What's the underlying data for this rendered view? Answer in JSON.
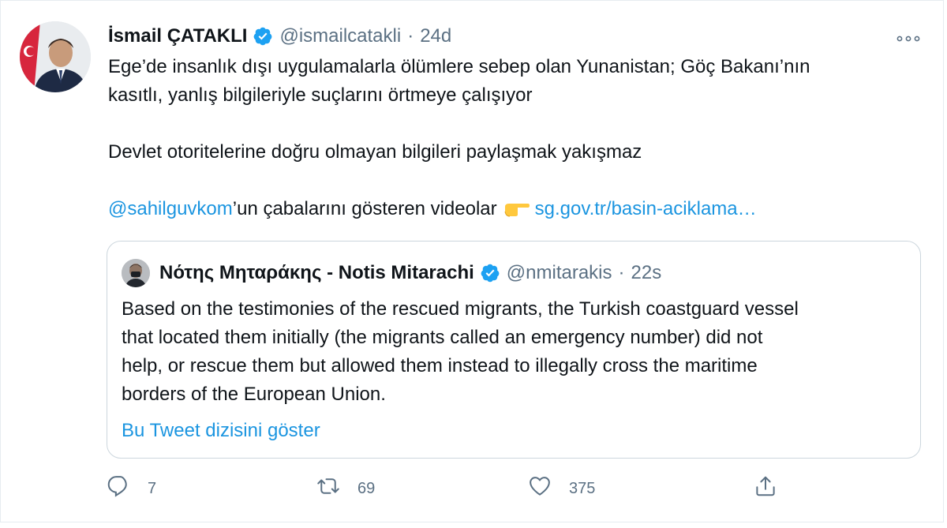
{
  "tweet": {
    "author_name": "İsmail ÇATAKLI",
    "handle": "@ismailcatakli",
    "separator": "·",
    "time": "24d",
    "lines": [
      "Ege’de insanlık dışı uygulamalarla ölümlere sebep olan Yunanistan; Göç Bakanı’nın",
      "kasıtlı, yanlış bilgileriyle suçlarını örtmeye çalışıyor"
    ],
    "line2": "Devlet otoritelerine doğru olmayan bilgileri paylaşmak yakışmaz",
    "mention": "@sahilguvkom",
    "after_mention": "’un çabalarını gösteren videolar",
    "link": "sg.gov.tr/basin-aciklama…"
  },
  "quote": {
    "author_name": "Νότης Μηταράκης - Notis Mitarachi",
    "handle": "@nmitarakis",
    "separator": "·",
    "time": "22s",
    "lines": [
      "Based on the testimonies of the rescued migrants, the Turkish coastguard vessel",
      "that located them initially (the migrants called an emergency number) did not",
      "help, or rescue them but allowed them instead to illegally cross the maritime",
      "borders of the European Union."
    ],
    "show_thread": "Bu Tweet dizisini göster"
  },
  "actions": {
    "reply_count": "7",
    "retweet_count": "69",
    "like_count": "375"
  },
  "icons": {
    "verified": "verified-badge-icon",
    "more": "more-dots-icon",
    "reply": "reply-icon",
    "retweet": "retweet-icon",
    "like": "heart-icon",
    "share": "share-icon",
    "emoji": "pointing-hand-emoji"
  },
  "colors": {
    "link": "#1b95e0",
    "muted": "#5b7083",
    "verified": "#1da1f2"
  }
}
